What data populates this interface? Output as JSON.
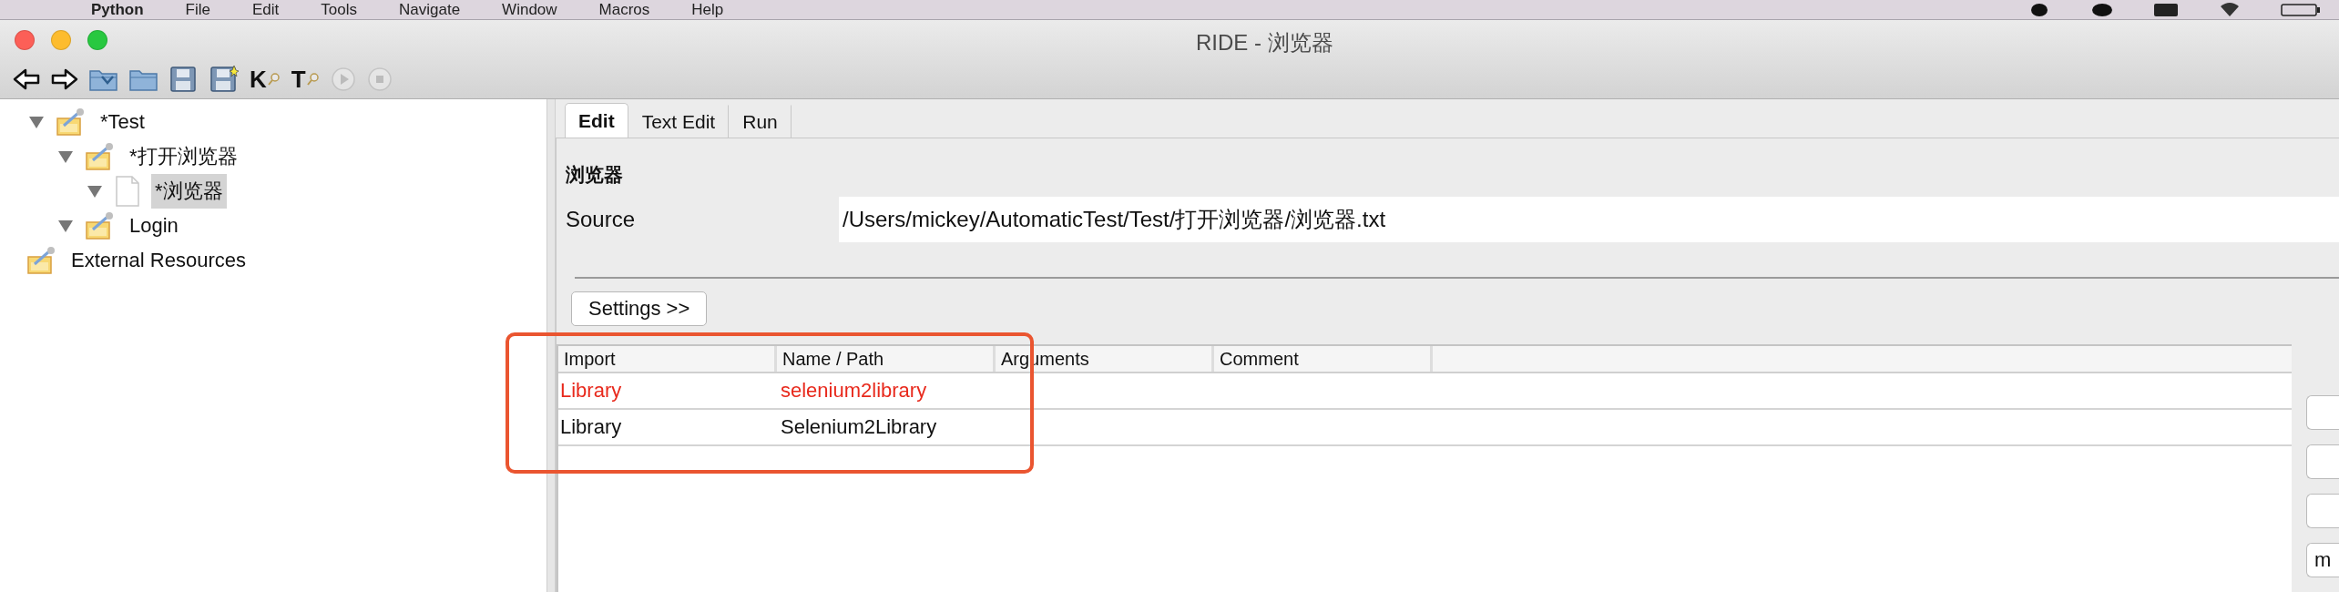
{
  "menu_bar": {
    "items": [
      "Python",
      "File",
      "Edit",
      "Tools",
      "Navigate",
      "Window",
      "Macros",
      "Help"
    ]
  },
  "window": {
    "title": "RIDE - 浏览器"
  },
  "toolbar": [
    {
      "kind": "back"
    },
    {
      "kind": "forward"
    },
    {
      "kind": "open"
    },
    {
      "kind": "folder"
    },
    {
      "kind": "save"
    },
    {
      "kind": "save_all"
    },
    {
      "kind": "search",
      "label": "K"
    },
    {
      "kind": "search",
      "label": "T"
    },
    {
      "kind": "run",
      "disabled": true
    },
    {
      "kind": "stop",
      "disabled": true
    }
  ],
  "tree": [
    {
      "label": "*Test",
      "kind": "suite",
      "expanded": true,
      "selected": false,
      "children": [
        {
          "label": "*打开浏览器",
          "kind": "suite",
          "expanded": true,
          "selected": false,
          "children": [
            {
              "label": "*浏览器",
              "kind": "file",
              "expanded": true,
              "selected": true
            }
          ]
        },
        {
          "label": "Login",
          "kind": "suite",
          "expanded": true,
          "selected": false
        }
      ]
    },
    {
      "label": "External Resources",
      "kind": "suite",
      "selected": false
    }
  ],
  "tabs": [
    {
      "label": "Edit",
      "selected": true
    },
    {
      "label": "Text Edit",
      "selected": false
    },
    {
      "label": "Run",
      "selected": false
    }
  ],
  "editor": {
    "heading": "浏览器",
    "source_label": "Source",
    "source_value": "/Users/mickey/AutomaticTest/Test/打开浏览器/浏览器.txt",
    "settings_button": "Settings >>"
  },
  "imports": {
    "columns": [
      "Import",
      "Name / Path",
      "Arguments",
      "Comment"
    ],
    "rows": [
      {
        "cells": [
          "Library",
          "selenium2library"
        ],
        "error": true
      },
      {
        "cells": [
          "Library",
          "Selenium2Library"
        ],
        "error": false
      }
    ]
  },
  "side_buttons": [
    {
      "kind": "button"
    },
    {
      "kind": "button"
    },
    {
      "kind": "button"
    },
    {
      "kind": "button",
      "label": "m"
    }
  ],
  "annotation": {
    "kind": "outline"
  }
}
